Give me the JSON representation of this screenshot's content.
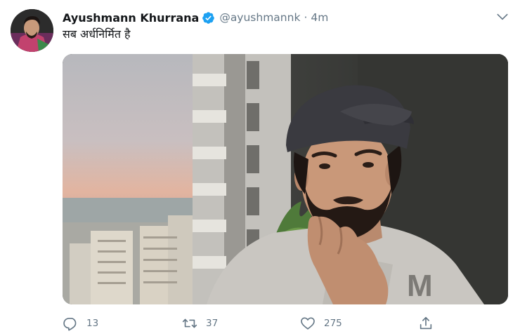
{
  "tweet": {
    "display_name": "Ayushmann Khurrana",
    "handle": "@ayushmannk",
    "separator": "·",
    "time": "4m",
    "text": "सब अर्धनिर्मित है",
    "verified": true,
    "media": {
      "type": "video-frame"
    },
    "actions": {
      "reply_count": "13",
      "retweet_count": "37",
      "like_count": "275"
    },
    "icons": {
      "verified": "verified-badge-icon",
      "caret": "chevron-down-icon",
      "reply": "reply-icon",
      "retweet": "retweet-icon",
      "like": "heart-icon",
      "share": "share-icon"
    },
    "colors": {
      "name": "#14171a",
      "secondary": "#657786",
      "verified": "#1da1f2"
    }
  }
}
